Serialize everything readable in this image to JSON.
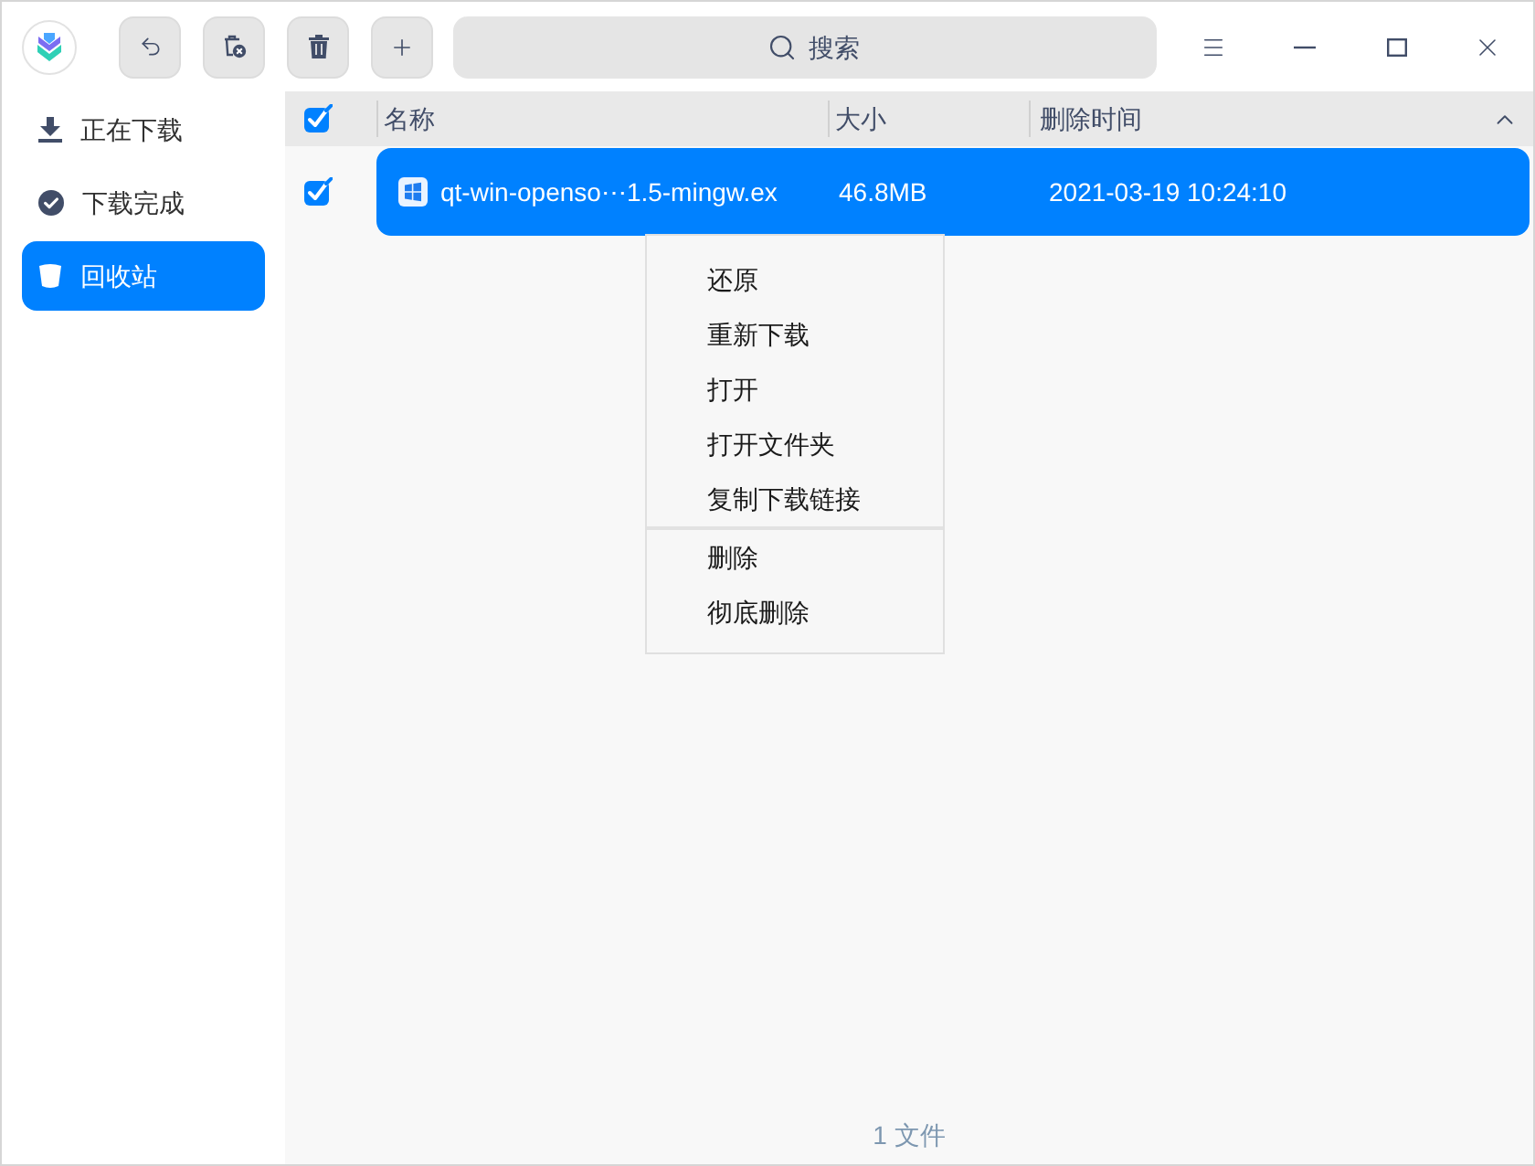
{
  "title_bar": {
    "search": {
      "placeholder": "搜索"
    }
  },
  "sidebar": {
    "items": [
      {
        "label": "正在下载",
        "selected": false
      },
      {
        "label": "下载完成",
        "selected": false
      },
      {
        "label": "回收站",
        "selected": true
      }
    ]
  },
  "table": {
    "all_checked": true,
    "columns": [
      {
        "label": "名称"
      },
      {
        "label": "大小"
      },
      {
        "label": "删除时间"
      }
    ],
    "rows": [
      {
        "checked": true,
        "selected": true,
        "name": "qt-win-openso⋯1.5-mingw.ex",
        "size": "46.8MB",
        "deleted_at": "2021-03-19 10:24:10"
      }
    ]
  },
  "context_menu": {
    "sections": [
      {
        "items": [
          "还原",
          "重新下载",
          "打开",
          "打开文件夹",
          "复制下载链接"
        ]
      },
      {
        "items": [
          "删除",
          "彻底删除"
        ]
      }
    ]
  },
  "status_bar": {
    "file_count": "1 文件"
  }
}
